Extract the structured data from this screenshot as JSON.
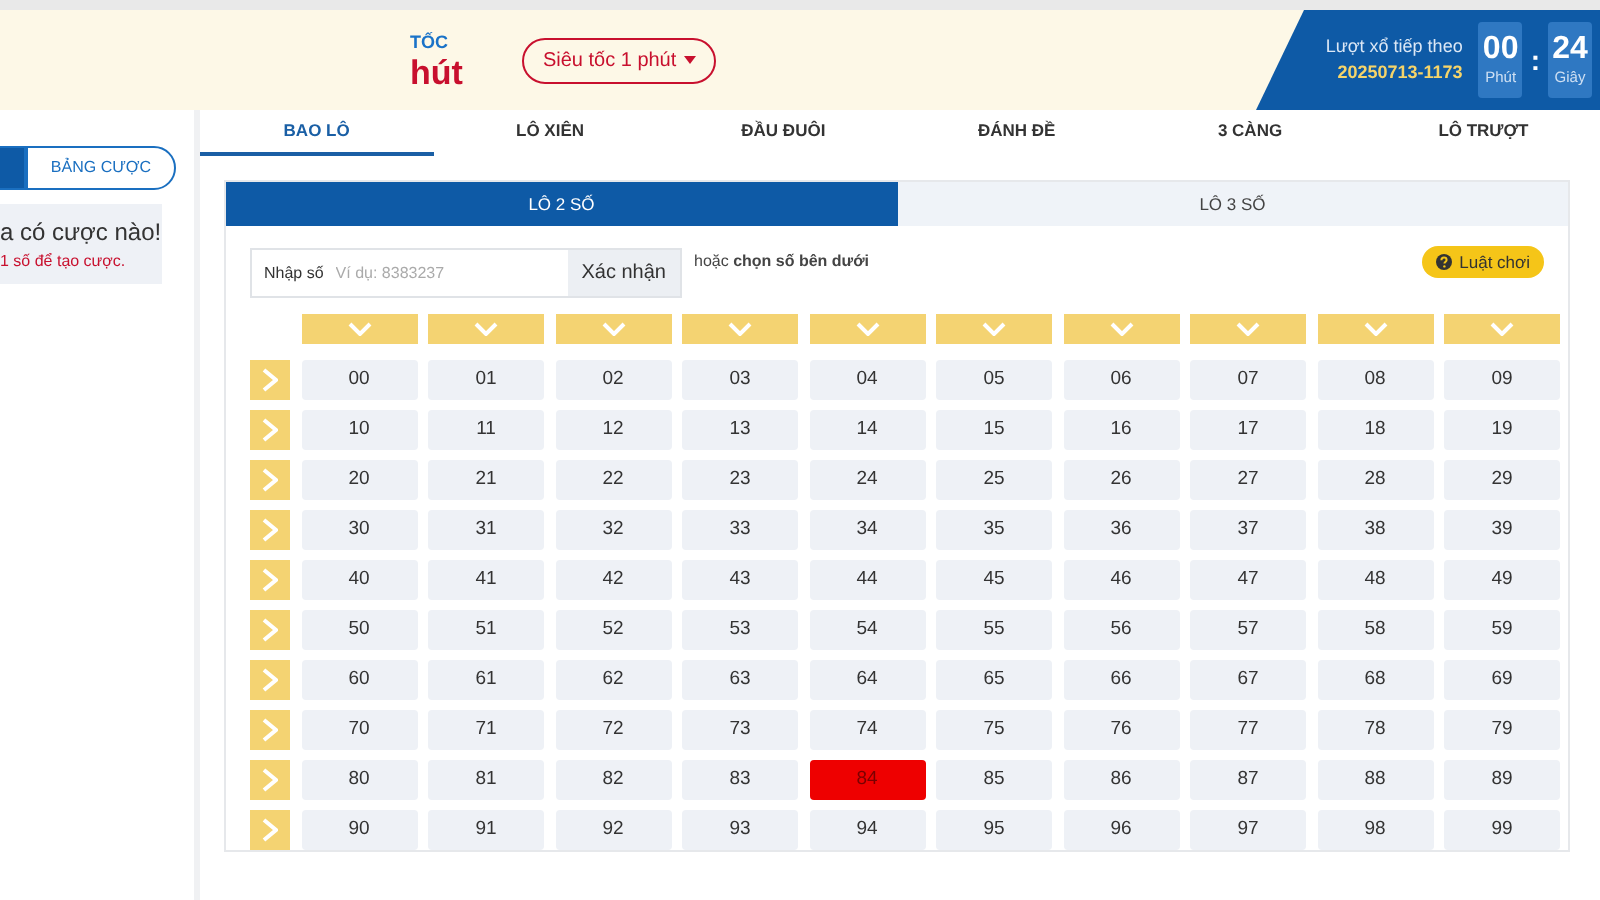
{
  "header": {
    "title_top": "TỐC",
    "title_main": "hút",
    "mode_dropdown": "Siêu tốc 1 phút",
    "next_draw_label": "Lượt xổ tiếp theo",
    "next_draw_id": "20250713-1173",
    "timer": [
      {
        "value": "00",
        "unit": "Phút"
      },
      {
        "value": "24",
        "unit": "Giây"
      }
    ],
    "timer_separator": ":"
  },
  "sidebar": {
    "tabs": [
      {
        "selected": true
      },
      {
        "label": "BẢNG CƯỢC",
        "selected": false
      }
    ],
    "empty_title": "a có cược nào!",
    "empty_hint": "1 số để tạo cược."
  },
  "bet_tabs": [
    {
      "label": "BAO LÔ",
      "selected": true
    },
    {
      "label": "LÔ XIÊN",
      "selected": false
    },
    {
      "label": "ĐẦU ĐUÔI",
      "selected": false
    },
    {
      "label": "ĐÁNH ĐỀ",
      "selected": false
    },
    {
      "label": "3 CÀNG",
      "selected": false
    },
    {
      "label": "LÔ TRƯỢT",
      "selected": false
    }
  ],
  "sub_tabs": [
    {
      "label": "LÔ 2 SỐ",
      "selected": true
    },
    {
      "label": "LÔ 3 SỐ",
      "selected": false
    }
  ],
  "number_input": {
    "label": "Nhập số",
    "placeholder": "Ví dụ: 8383237",
    "button": "Xác nhận",
    "hint": "hoặc **chọn số bên dưới**"
  },
  "rules_button": "Luật chơi",
  "grid": [
    {
      "cells": [
        {
          "label": "00",
          "selected": false
        },
        {
          "label": "01",
          "selected": false
        },
        {
          "label": "02",
          "selected": false
        },
        {
          "label": "03",
          "selected": false
        },
        {
          "label": "04",
          "selected": false
        },
        {
          "label": "05",
          "selected": false
        },
        {
          "label": "06",
          "selected": false
        },
        {
          "label": "07",
          "selected": false
        },
        {
          "label": "08",
          "selected": false
        },
        {
          "label": "09",
          "selected": false
        }
      ]
    },
    {
      "cells": [
        {
          "label": "10",
          "selected": false
        },
        {
          "label": "11",
          "selected": false
        },
        {
          "label": "12",
          "selected": false
        },
        {
          "label": "13",
          "selected": false
        },
        {
          "label": "14",
          "selected": false
        },
        {
          "label": "15",
          "selected": false
        },
        {
          "label": "16",
          "selected": false
        },
        {
          "label": "17",
          "selected": false
        },
        {
          "label": "18",
          "selected": false
        },
        {
          "label": "19",
          "selected": false
        }
      ]
    },
    {
      "cells": [
        {
          "label": "20",
          "selected": false
        },
        {
          "label": "21",
          "selected": false
        },
        {
          "label": "22",
          "selected": false
        },
        {
          "label": "23",
          "selected": false
        },
        {
          "label": "24",
          "selected": false
        },
        {
          "label": "25",
          "selected": false
        },
        {
          "label": "26",
          "selected": false
        },
        {
          "label": "27",
          "selected": false
        },
        {
          "label": "28",
          "selected": false
        },
        {
          "label": "29",
          "selected": false
        }
      ]
    },
    {
      "cells": [
        {
          "label": "30",
          "selected": false
        },
        {
          "label": "31",
          "selected": false
        },
        {
          "label": "32",
          "selected": false
        },
        {
          "label": "33",
          "selected": false
        },
        {
          "label": "34",
          "selected": false
        },
        {
          "label": "35",
          "selected": false
        },
        {
          "label": "36",
          "selected": false
        },
        {
          "label": "37",
          "selected": false
        },
        {
          "label": "38",
          "selected": false
        },
        {
          "label": "39",
          "selected": false
        }
      ]
    },
    {
      "cells": [
        {
          "label": "40",
          "selected": false
        },
        {
          "label": "41",
          "selected": false
        },
        {
          "label": "42",
          "selected": false
        },
        {
          "label": "43",
          "selected": false
        },
        {
          "label": "44",
          "selected": false
        },
        {
          "label": "45",
          "selected": false
        },
        {
          "label": "46",
          "selected": false
        },
        {
          "label": "47",
          "selected": false
        },
        {
          "label": "48",
          "selected": false
        },
        {
          "label": "49",
          "selected": false
        }
      ]
    },
    {
      "cells": [
        {
          "label": "50",
          "selected": false
        },
        {
          "label": "51",
          "selected": false
        },
        {
          "label": "52",
          "selected": false
        },
        {
          "label": "53",
          "selected": false
        },
        {
          "label": "54",
          "selected": false
        },
        {
          "label": "55",
          "selected": false
        },
        {
          "label": "56",
          "selected": false
        },
        {
          "label": "57",
          "selected": false
        },
        {
          "label": "58",
          "selected": false
        },
        {
          "label": "59",
          "selected": false
        }
      ]
    },
    {
      "cells": [
        {
          "label": "60",
          "selected": false
        },
        {
          "label": "61",
          "selected": false
        },
        {
          "label": "62",
          "selected": false
        },
        {
          "label": "63",
          "selected": false
        },
        {
          "label": "64",
          "selected": false
        },
        {
          "label": "65",
          "selected": false
        },
        {
          "label": "66",
          "selected": false
        },
        {
          "label": "67",
          "selected": false
        },
        {
          "label": "68",
          "selected": false
        },
        {
          "label": "69",
          "selected": false
        }
      ]
    },
    {
      "cells": [
        {
          "label": "70",
          "selected": false
        },
        {
          "label": "71",
          "selected": false
        },
        {
          "label": "72",
          "selected": false
        },
        {
          "label": "73",
          "selected": false
        },
        {
          "label": "74",
          "selected": false
        },
        {
          "label": "75",
          "selected": false
        },
        {
          "label": "76",
          "selected": false
        },
        {
          "label": "77",
          "selected": false
        },
        {
          "label": "78",
          "selected": false
        },
        {
          "label": "79",
          "selected": false
        }
      ]
    },
    {
      "cells": [
        {
          "label": "80",
          "selected": false
        },
        {
          "label": "81",
          "selected": false
        },
        {
          "label": "82",
          "selected": false
        },
        {
          "label": "83",
          "selected": false
        },
        {
          "label": "84",
          "selected": true
        },
        {
          "label": "85",
          "selected": false
        },
        {
          "label": "86",
          "selected": false
        },
        {
          "label": "87",
          "selected": false
        },
        {
          "label": "88",
          "selected": false
        },
        {
          "label": "89",
          "selected": false
        }
      ]
    },
    {
      "cells": [
        {
          "label": "90",
          "selected": false
        },
        {
          "label": "91",
          "selected": false
        },
        {
          "label": "92",
          "selected": false
        },
        {
          "label": "93",
          "selected": false
        },
        {
          "label": "94",
          "selected": false
        },
        {
          "label": "95",
          "selected": false
        },
        {
          "label": "96",
          "selected": false
        },
        {
          "label": "97",
          "selected": false
        },
        {
          "label": "98",
          "selected": false
        },
        {
          "label": "99",
          "selected": false
        }
      ]
    }
  ]
}
